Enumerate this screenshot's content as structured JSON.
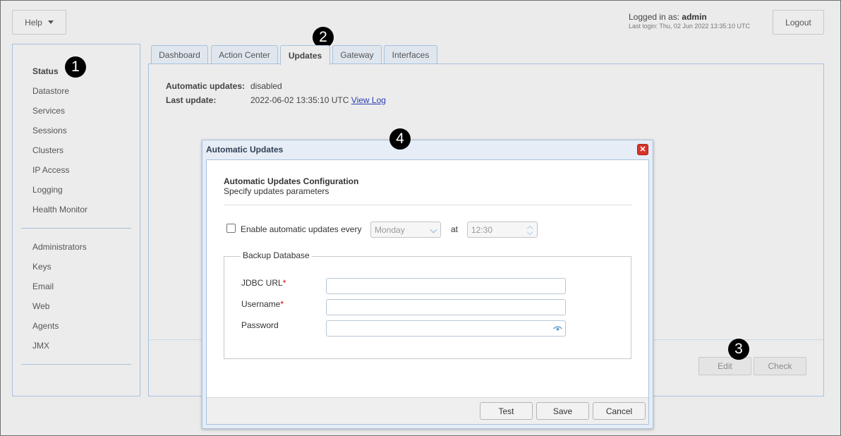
{
  "header": {
    "help_label": "Help",
    "logged_in_prefix": "Logged in as:",
    "username": "admin",
    "last_login": "Last login: Thu, 02 Jun 2022 13:35:10 UTC",
    "logout_label": "Logout"
  },
  "sidebar": {
    "group1": [
      {
        "label": "Status",
        "active": true
      },
      {
        "label": "Datastore"
      },
      {
        "label": "Services"
      },
      {
        "label": "Sessions"
      },
      {
        "label": "Clusters"
      },
      {
        "label": "IP Access"
      },
      {
        "label": "Logging"
      },
      {
        "label": "Health Monitor"
      }
    ],
    "group2": [
      {
        "label": "Administrators"
      },
      {
        "label": "Keys"
      },
      {
        "label": "Email"
      },
      {
        "label": "Web"
      },
      {
        "label": "Agents"
      },
      {
        "label": "JMX"
      }
    ]
  },
  "tabs": [
    {
      "label": "Dashboard"
    },
    {
      "label": "Action Center"
    },
    {
      "label": "Updates",
      "active": true
    },
    {
      "label": "Gateway"
    },
    {
      "label": "Interfaces"
    }
  ],
  "updates": {
    "auto_label": "Automatic updates:",
    "auto_value": "disabled",
    "last_label": "Last update:",
    "last_value": "2022-06-02 13:35:10 UTC",
    "view_log": "View Log",
    "edit_label": "Edit",
    "check_label": "Check"
  },
  "badges": {
    "b1": "1",
    "b2": "2",
    "b3": "3",
    "b4": "4"
  },
  "dialog": {
    "title": "Automatic Updates",
    "close_glyph": "✕",
    "config_title": "Automatic Updates Configuration",
    "config_subtitle": "Specify updates parameters",
    "enable_label": "Enable automatic updates every",
    "enable_checked": false,
    "day_value": "Monday",
    "at_label": "at",
    "time_value": "12:30",
    "backup_legend": "Backup Database",
    "jdbc_label": "JDBC URL",
    "username_label": "Username",
    "password_label": "Password",
    "required_mark": "*",
    "jdbc_value": "",
    "username_value": "",
    "password_value": "",
    "test_label": "Test",
    "save_label": "Save",
    "cancel_label": "Cancel"
  },
  "colors": {
    "panel_border": "#a7c1dd",
    "link": "#2a3fae",
    "required": "#dd0000",
    "close_button": "#d7342a"
  }
}
